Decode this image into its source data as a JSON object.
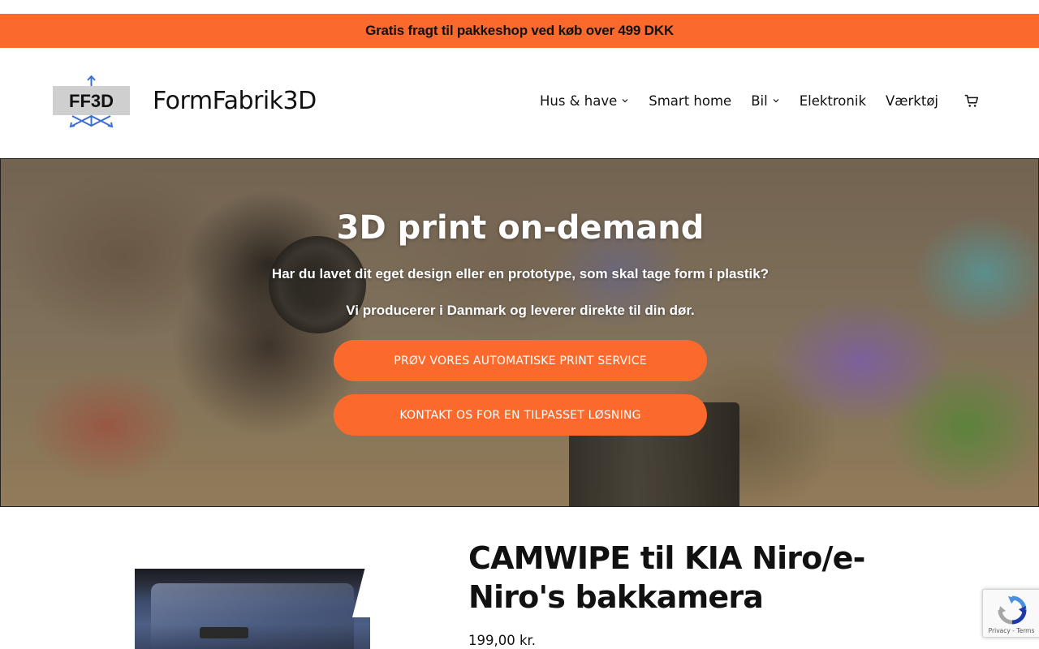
{
  "announcement": {
    "text": "Gratis fragt til pakkeshop ved køb over 499 DKK"
  },
  "header": {
    "logo_text": "FF3D",
    "site_title": "FormFabrik3D",
    "nav": [
      {
        "label": "Hus & have",
        "has_dropdown": true
      },
      {
        "label": "Smart home",
        "has_dropdown": false
      },
      {
        "label": "Bil",
        "has_dropdown": true
      },
      {
        "label": "Elektronik",
        "has_dropdown": false
      },
      {
        "label": "Værktøj",
        "has_dropdown": false
      }
    ],
    "cart_icon": "cart-icon"
  },
  "hero": {
    "title": "3D print on-demand",
    "paragraph1": "Har du lavet dit eget design eller en prototype, som skal tage form i plastik?",
    "paragraph2": "Vi producerer i Danmark og leverer direkte til din dør.",
    "button1": "PRØV VORES AUTOMATISKE PRINT SERVICE",
    "button2": "KONTAKT OS FOR EN TILPASSET LØSNING"
  },
  "product": {
    "title": "CAMWIPE til KIA Niro/e-Niro's bakkamera",
    "price": "199,00 kr."
  },
  "recaptcha": {
    "links": "Privacy - Terms"
  },
  "colors": {
    "accent": "#fb6a2c",
    "logo_blue": "#3b6fd4",
    "text": "#111111"
  }
}
